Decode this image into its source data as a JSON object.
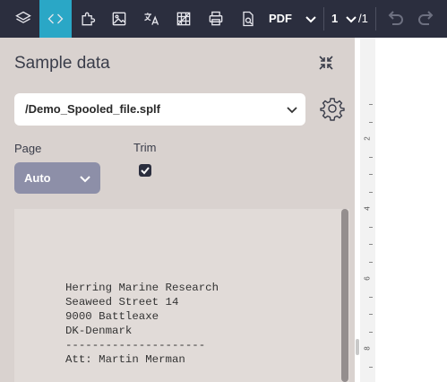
{
  "toolbar": {
    "icons": [
      "layers-icon",
      "code-icon",
      "plugin-icon",
      "image-icon",
      "translate-icon",
      "grid-icon",
      "print-icon",
      "document-search-icon"
    ],
    "format": "PDF",
    "page_current": "1",
    "page_total": "/1",
    "accent": "#2aa7c6"
  },
  "panel": {
    "title": "Sample data",
    "file_select_value": "/Demo_Spooled_file.splf",
    "page_label": "Page",
    "page_value": "Auto",
    "trim_label": "Trim",
    "trim_checked": true,
    "sample_lines": [
      "Herring Marine Research",
      "Seaweed Street 14",
      "9000 Battleaxe",
      "DK-Denmark",
      "---------------------",
      "Att: Martin Merman"
    ]
  },
  "ruler": {
    "labels": [
      "2",
      "4",
      "6",
      "8"
    ]
  }
}
